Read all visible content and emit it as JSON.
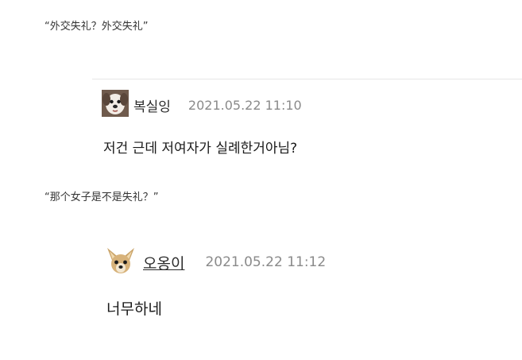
{
  "captions": [
    "“外交失礼？外交失礼”",
    "“那个女子是不是失礼？”"
  ],
  "comments": [
    {
      "avatar_icon": "puppy-face-icon",
      "username": "복실잉",
      "timestamp": "2021.05.22 11:10",
      "text": "저건 근데 저여자가 실례한거아님?"
    },
    {
      "avatar_icon": "chihuahua-face-icon",
      "username": "오옹이",
      "timestamp": "2021.05.22 11:12",
      "text": "너무하네"
    }
  ]
}
